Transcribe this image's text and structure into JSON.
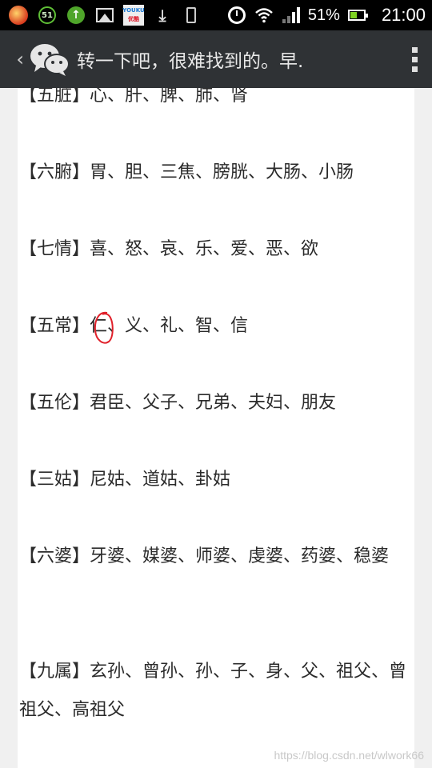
{
  "status_bar": {
    "notification_icons": [
      "app-icon",
      "ring-51-icon",
      "upload-icon",
      "image-icon",
      "youku-icon",
      "download-icon",
      "phone-icon"
    ],
    "ring_value": "51",
    "youku_label_top": "YOUKU",
    "youku_label_bottom": "优酷",
    "battery": "51%",
    "battery_level": 0.51,
    "time": "21:00"
  },
  "title_bar": {
    "title": "转一下吧，很难找到的。早."
  },
  "article": {
    "entries": [
      {
        "tag": "【五脏】",
        "text": "心、肝、脾、肺、肾"
      },
      {
        "tag": "【六腑】",
        "text": "胃、胆、三焦、膀胱、大肠、小肠"
      },
      {
        "tag": "【七情】",
        "text": "喜、怒、哀、乐、爱、恶、欲"
      },
      {
        "tag": "【五常】",
        "text": "仁、义、礼、智、信"
      },
      {
        "tag": "【五伦】",
        "text": "君臣、父子、兄弟、夫妇、朋友"
      },
      {
        "tag": "【三姑】",
        "text": "尼姑、道姑、卦姑"
      },
      {
        "tag": "【六婆】",
        "text": "牙婆、媒婆、师婆、虔婆、药婆、稳婆"
      },
      {
        "tag": "【九属】",
        "text": "玄孙、曾孙、孙、子、身、父、祖父、曾祖父、高祖父"
      }
    ]
  },
  "watermark": "https://blog.csdn.net/wlwork66",
  "colors": {
    "status_bar_bg": "#000000",
    "title_bar_bg": "#2f3235",
    "content_bg": "#ffffff",
    "page_bg": "#f0f0f0",
    "text": "#2b2b2b",
    "annotation": "#e0202a"
  }
}
